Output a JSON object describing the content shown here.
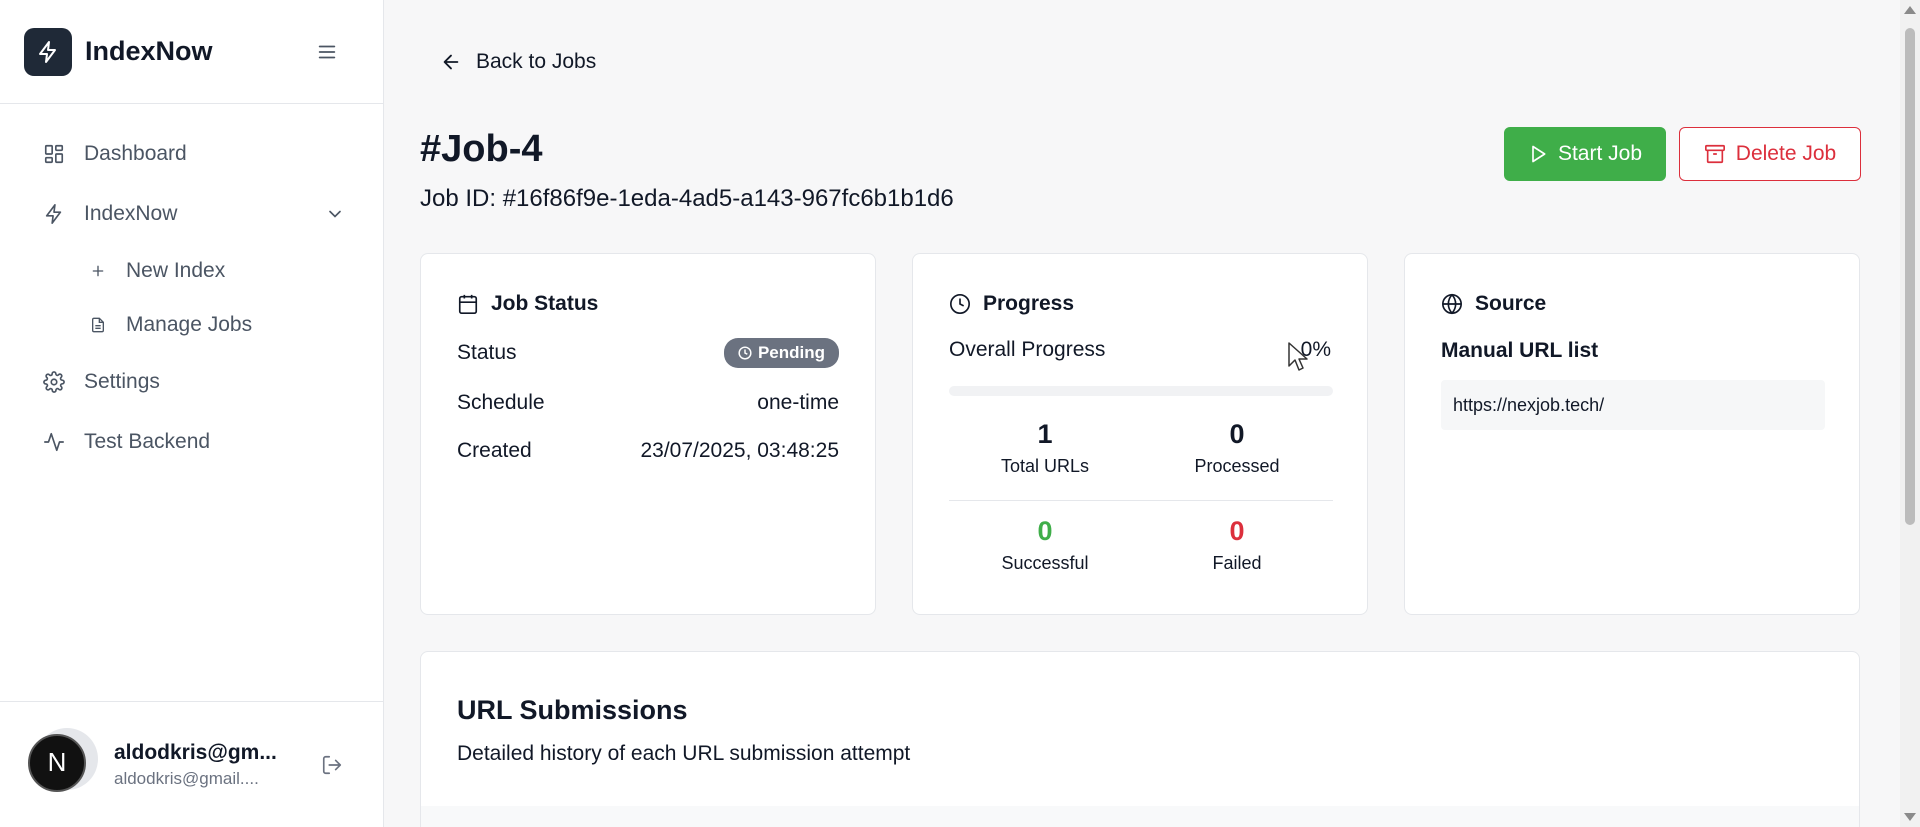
{
  "sidebar": {
    "brand": "IndexNow",
    "items": [
      {
        "label": "Dashboard",
        "icon": "dashboard-icon"
      },
      {
        "label": "IndexNow",
        "icon": "bolt-icon"
      },
      {
        "label": "New Index",
        "icon": "plus-icon"
      },
      {
        "label": "Manage Jobs",
        "icon": "file-icon"
      },
      {
        "label": "Settings",
        "icon": "gear-icon"
      },
      {
        "label": "Test Backend",
        "icon": "activity-icon"
      }
    ],
    "user": {
      "avatar_letter": "N",
      "name": "aldodkris@gm...",
      "email": "aldodkris@gmail...."
    }
  },
  "header": {
    "back_label": "Back to Jobs",
    "title": "#Job-4",
    "job_id": "Job ID: #16f86f9e-1eda-4ad5-a143-967fc6b1b1d6",
    "start_label": "Start Job",
    "delete_label": "Delete Job"
  },
  "status_card": {
    "title": "Job Status",
    "status_label": "Status",
    "status_value": "Pending",
    "schedule_label": "Schedule",
    "schedule_value": "one-time",
    "created_label": "Created",
    "created_value": "23/07/2025, 03:48:25"
  },
  "progress_card": {
    "title": "Progress",
    "overall_label": "Overall Progress",
    "overall_value": "0%",
    "progress_fraction": 0,
    "total": {
      "value": "1",
      "label": "Total URLs"
    },
    "processed": {
      "value": "0",
      "label": "Processed"
    },
    "successful": {
      "value": "0",
      "label": "Successful"
    },
    "failed": {
      "value": "0",
      "label": "Failed"
    }
  },
  "source_card": {
    "title": "Source",
    "type": "Manual URL list",
    "url": "https://nexjob.tech/"
  },
  "submissions": {
    "title": "URL Submissions",
    "description": "Detailed history of each URL submission attempt"
  },
  "colors": {
    "success": "#3fae49",
    "danger": "#dc2f3c",
    "badge": "#6b7280",
    "logo_bg": "#1f2937"
  }
}
